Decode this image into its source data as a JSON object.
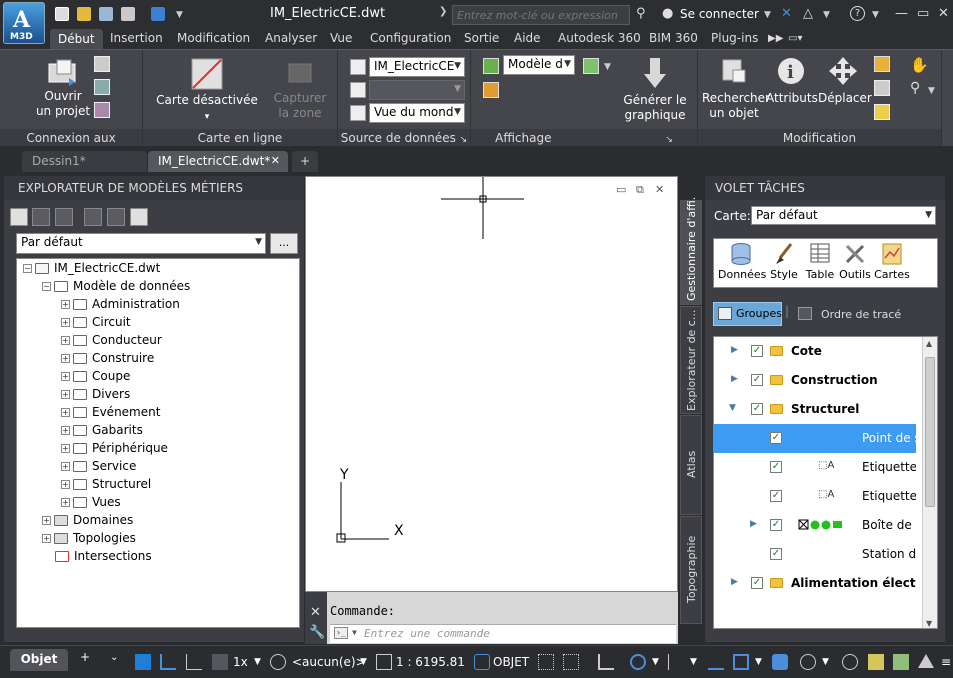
{
  "app": {
    "logo_label": "M3D",
    "logo_letter": "A"
  },
  "window": {
    "title": "IM_ElectricCE.dwt"
  },
  "search": {
    "placeholder": "Entrez mot-clé ou expression"
  },
  "user": {
    "signin": "Se connecter"
  },
  "menu_tabs": [
    {
      "label": "Début"
    },
    {
      "label": "Insertion"
    },
    {
      "label": "Modification"
    },
    {
      "label": "Analyser"
    },
    {
      "label": "Vue"
    },
    {
      "label": "Configuration"
    },
    {
      "label": "Sortie"
    },
    {
      "label": "Aide"
    },
    {
      "label": "Autodesk 360"
    },
    {
      "label": "BIM 360"
    },
    {
      "label": "Plug-ins"
    }
  ],
  "ribbon": {
    "panels": {
      "connexion": "Connexion aux données",
      "carte_en_ligne": "Carte en ligne",
      "source": "Source de données",
      "affichage": "Affichage",
      "modification": "Modification"
    },
    "buttons": {
      "ouvrir": "Ouvrir",
      "ouvrir2": "un projet",
      "carte": "Carte désactivée",
      "capturer": "Capturer",
      "capturer2": "la zone",
      "generer": "Générer le",
      "generer2": "graphique",
      "rechercher": "Rechercher",
      "rechercher2": "un objet",
      "attributs": "Attributs",
      "deplacer": "Déplacer"
    },
    "combos": {
      "source1": "IM_ElectricCE",
      "source2": "",
      "vue": "Vue du mond",
      "modele": "Modèle d"
    }
  },
  "doc_tabs": [
    {
      "label": "Dessin1*"
    },
    {
      "label": "IM_ElectricCE.dwt*"
    }
  ],
  "left_palette": {
    "title": "EXPLORATEUR DE MODÈLES MÉTIERS",
    "combo": "Par défaut",
    "browse": "...",
    "tree": {
      "root": "IM_ElectricCE.dwt",
      "model": "Modèle de données",
      "folders": [
        "Administration",
        "Circuit",
        "Conducteur",
        "Construire",
        "Coupe",
        "Divers",
        "Evénement",
        "Gabarits",
        "Périphérique",
        "Service",
        "Structurel",
        "Vues"
      ],
      "domaines": "Domaines",
      "topologies": "Topologies",
      "intersections": "Intersections"
    }
  },
  "command": {
    "label": "Commande:",
    "placeholder": "Entrez une commande"
  },
  "vertical_tabs": [
    {
      "label": "Gestionnaire d'affi."
    },
    {
      "label": "Explorateur de c..."
    },
    {
      "label": "Atlas"
    },
    {
      "label": "Topographie"
    }
  ],
  "right_palette": {
    "title": "VOLET TÂCHES",
    "carte_label": "Carte:",
    "carte_value": "Par défaut",
    "tools": [
      "Données",
      "Style",
      "Table",
      "Outils",
      "Cartes"
    ],
    "groupes": "Groupes",
    "ordre": "Ordre de tracé",
    "layers": [
      {
        "label": "Cote"
      },
      {
        "label": "Construction"
      },
      {
        "label": "Structurel"
      },
      {
        "label": "Point de st"
      },
      {
        "label": "Etiquette c"
      },
      {
        "label": "Etiquette d"
      },
      {
        "label": "Boîte de c"
      },
      {
        "label": "Station de"
      },
      {
        "label": "Alimentation électrique"
      }
    ]
  },
  "status": {
    "objet_tab": "Objet",
    "scale_mult": "1x",
    "annot": "<aucun(e)>",
    "scale": "1 : 6195.81",
    "objet_mode": "OBJET"
  },
  "colors": {
    "accent": "#3d9bf2",
    "ribbon_bg": "#44464c",
    "dark_bg": "#2a2c30"
  }
}
